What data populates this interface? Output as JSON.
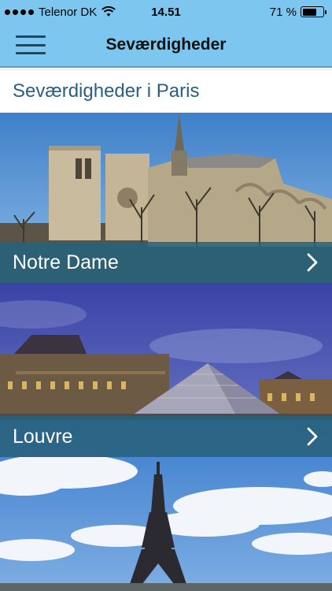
{
  "status_bar": {
    "carrier": "Telenor DK",
    "time": "14.51",
    "battery_percent_label": "71 %",
    "battery_level": 0.71,
    "icons": [
      "signal-dots-icon",
      "wifi-icon",
      "battery-icon"
    ]
  },
  "nav": {
    "title": "Seværdigheder",
    "menu_icon": "hamburger-menu-icon"
  },
  "section": {
    "title": "Seværdigheder i Paris"
  },
  "attractions": [
    {
      "label": "Notre Dame",
      "image": "notre-dame-cathedral-photo",
      "icon": "chevron-right-icon"
    },
    {
      "label": "Louvre",
      "image": "louvre-pyramid-photo",
      "icon": "chevron-right-icon"
    },
    {
      "label": "",
      "image": "eiffel-tower-photo",
      "icon": ""
    }
  ],
  "colors": {
    "header_bg": "#7cc6ef",
    "bar_bg": "#23627d",
    "section_title": "#2a5f7f"
  }
}
